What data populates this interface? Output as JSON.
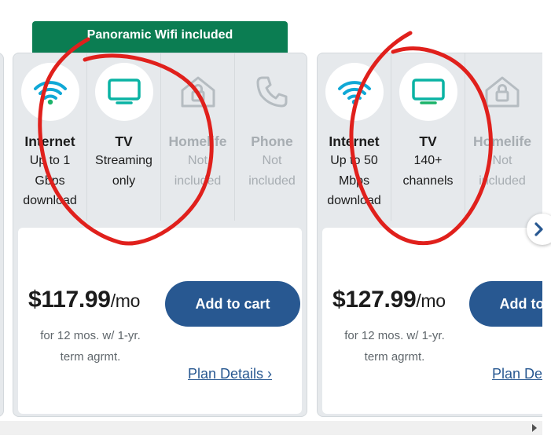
{
  "banner": {
    "text": "Panoramic Wifi included"
  },
  "plans": [
    {
      "features": [
        {
          "icon": "wifi-icon",
          "title": "Internet",
          "desc": [
            "Up to 1",
            "Gbps",
            "download"
          ]
        },
        {
          "icon": "tv-icon",
          "title": "TV",
          "desc": [
            "Streaming",
            "only"
          ]
        },
        {
          "icon": "home-lock-icon",
          "title": "Homelife",
          "desc": [
            "Not",
            "included"
          ]
        },
        {
          "icon": "phone-icon",
          "title": "Phone",
          "desc": [
            "Not",
            "included"
          ]
        }
      ],
      "price": "$117.99",
      "price_unit": "/mo",
      "terms": [
        "for 12 mos. w/ 1-yr.",
        "term agrmt."
      ],
      "cart_label": "Add to cart",
      "details_label": "Plan Details ›"
    },
    {
      "features": [
        {
          "icon": "wifi-icon",
          "title": "Internet",
          "desc": [
            "Up to 50",
            "Mbps",
            "download"
          ]
        },
        {
          "icon": "tv-icon",
          "title": "TV",
          "desc": [
            "140+",
            "channels"
          ]
        },
        {
          "icon": "home-lock-icon",
          "title": "Homelife",
          "desc": [
            "Not",
            "included"
          ]
        }
      ],
      "price": "$127.99",
      "price_unit": "/mo",
      "terms": [
        "for 12 mos. w/ 1-yr.",
        "term agrmt."
      ],
      "cart_label": "Add to cart",
      "details_label": "Plan Details ›"
    }
  ],
  "next_arrow": "›",
  "colors": {
    "banner": "#0b7d52",
    "button": "#285891",
    "annotation": "#e0201c",
    "icon_active": "#0ab3a4"
  }
}
